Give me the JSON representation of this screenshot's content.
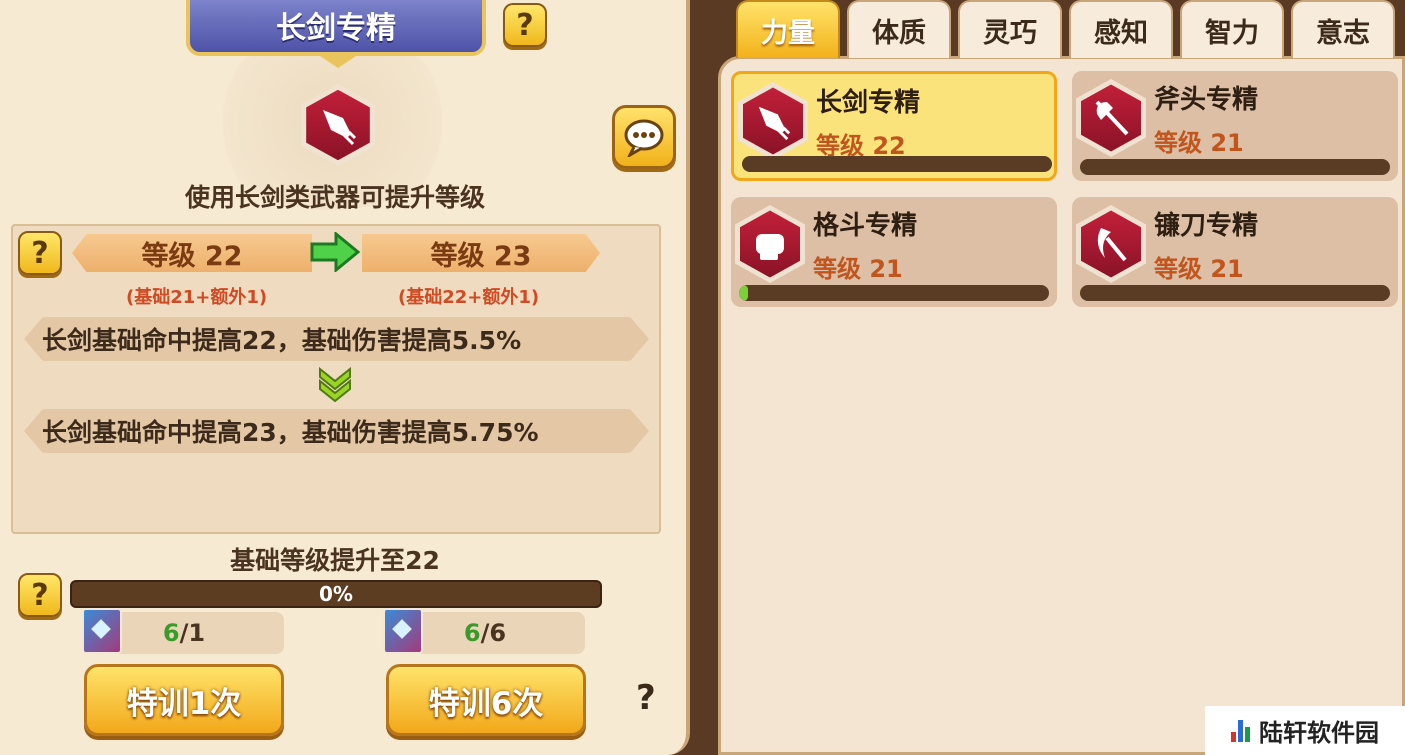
{
  "detail": {
    "title": "长剑专精",
    "description": "使用长剑类武器可提升等级",
    "current_level_label": "等级 22",
    "next_level_label": "等级 23",
    "current_breakdown": "(基础21+额外1)",
    "next_breakdown": "(基础22+额外1)",
    "current_effect": "长剑基础命中提高22，基础伤害提高5.5%",
    "next_effect": "长剑基础命中提高23，基础伤害提高5.75%",
    "base_level_text": "基础等级提升至22",
    "progress_text": "0%",
    "progress_value": 0,
    "cost_1": {
      "have": "6",
      "need": "/1"
    },
    "cost_6": {
      "have": "6",
      "need": "/6"
    },
    "train_1_label": "特训1次",
    "train_6_label": "特训6次",
    "help_label": "?",
    "bottom_question": "?"
  },
  "tabs": [
    {
      "label": "力量",
      "active": true
    },
    {
      "label": "体质",
      "active": false
    },
    {
      "label": "灵巧",
      "active": false
    },
    {
      "label": "感知",
      "active": false
    },
    {
      "label": "智力",
      "active": false
    },
    {
      "label": "意志",
      "active": false
    }
  ],
  "skills": [
    {
      "name": "长剑专精",
      "level": "等级 22",
      "progress": 0,
      "icon": "sword-icon",
      "selected": true
    },
    {
      "name": "斧头专精",
      "level": "等级 21",
      "progress": 0,
      "icon": "axe-icon",
      "selected": false
    },
    {
      "name": "格斗专精",
      "level": "等级 21",
      "progress": 0.03,
      "icon": "fist-icon",
      "selected": false
    },
    {
      "name": "镰刀专精",
      "level": "等级 21",
      "progress": 0,
      "icon": "scythe-icon",
      "selected": false
    }
  ],
  "watermark": "陆轩软件园",
  "colors": {
    "accent_gold": "#f2b11a",
    "banner_blue": "#5b60b2",
    "level_orange": "#c0561e",
    "progress_green": "#7ad13a",
    "icon_red": "#a8182f"
  }
}
